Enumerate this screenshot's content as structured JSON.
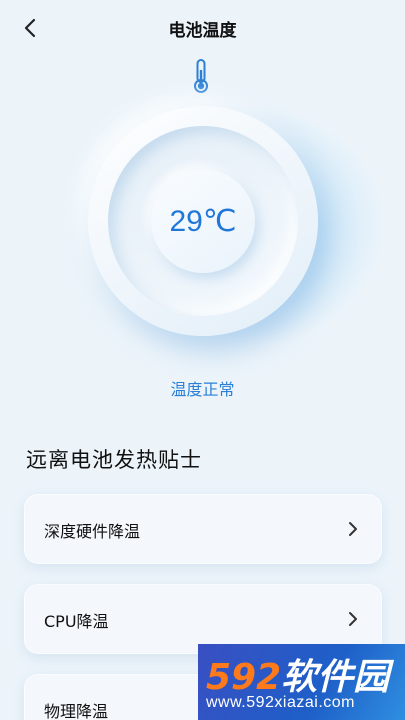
{
  "header": {
    "title": "电池温度",
    "back_icon": "chevron-left-icon"
  },
  "gauge": {
    "icon": "thermometer-icon",
    "temperature": "29℃",
    "status": "温度正常"
  },
  "tips": {
    "section_title": "远离电池发热贴士",
    "items": [
      {
        "label": "深度硬件降温",
        "icon": "chevron-right-icon"
      },
      {
        "label": "CPU降温",
        "icon": "chevron-right-icon"
      },
      {
        "label": "物理降温",
        "icon": "chevron-right-icon"
      }
    ]
  },
  "watermark": {
    "logo_number": "592",
    "logo_text": "软件园",
    "url": "www.592xiazai.com"
  },
  "colors": {
    "accent": "#1F78D8",
    "background": "#ECF4FA",
    "watermark_bg": "#1E5FC8",
    "watermark_number": "#FF7A1A"
  }
}
